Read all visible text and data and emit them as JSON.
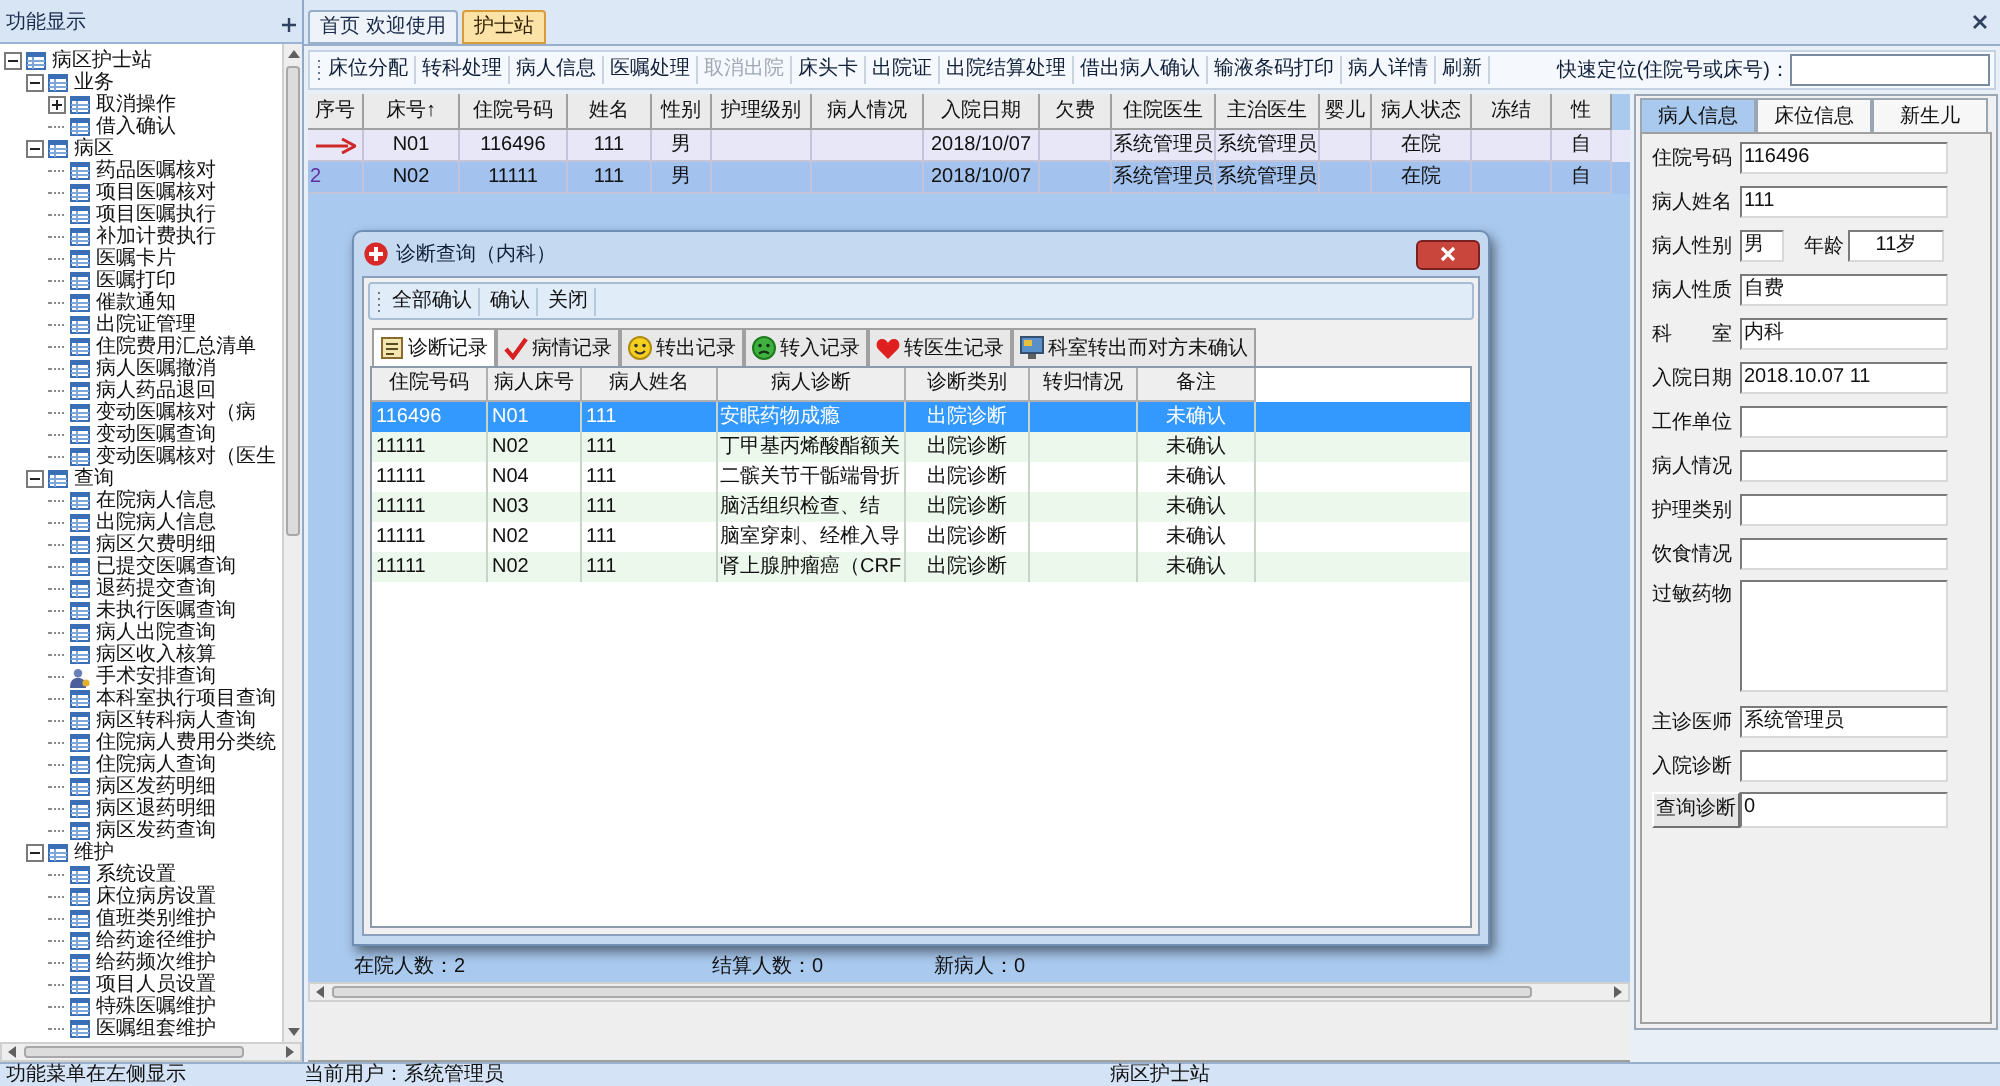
{
  "sidebar": {
    "title": "功能显示",
    "tree": [
      {
        "label": "病区护士站",
        "expanded": true,
        "children": [
          {
            "label": "业务",
            "expanded": true,
            "children": [
              {
                "label": "取消操作",
                "expanded": false
              },
              {
                "label": "借入确认"
              }
            ]
          },
          {
            "label": "病区",
            "expanded": true,
            "children": [
              {
                "label": "药品医嘱核对"
              },
              {
                "label": "项目医嘱核对"
              },
              {
                "label": "项目医嘱执行"
              },
              {
                "label": "补加计费执行"
              },
              {
                "label": "医嘱卡片"
              },
              {
                "label": "医嘱打印"
              },
              {
                "label": "催款通知"
              },
              {
                "label": "出院证管理"
              },
              {
                "label": "住院费用汇总清单"
              },
              {
                "label": "病人医嘱撤消"
              },
              {
                "label": "病人药品退回"
              },
              {
                "label": "变动医嘱核对（病"
              },
              {
                "label": "变动医嘱查询"
              },
              {
                "label": "变动医嘱核对（医生"
              }
            ]
          },
          {
            "label": "查询",
            "expanded": true,
            "children": [
              {
                "label": "在院病人信息",
                "kind": "table"
              },
              {
                "label": "出院病人信息",
                "kind": "table"
              },
              {
                "label": "病区欠费明细",
                "kind": "table"
              },
              {
                "label": "已提交医嘱查询",
                "kind": "table"
              },
              {
                "label": "退药提交查询",
                "kind": "table"
              },
              {
                "label": "未执行医嘱查询",
                "kind": "table"
              },
              {
                "label": "病人出院查询",
                "kind": "table"
              },
              {
                "label": "病区收入核算",
                "kind": "table"
              },
              {
                "label": "手术安排查询",
                "kind": "user"
              },
              {
                "label": "本科室执行项目查询",
                "kind": "table"
              },
              {
                "label": "病区转科病人查询",
                "kind": "table"
              },
              {
                "label": "住院病人费用分类统",
                "kind": "table"
              },
              {
                "label": "住院病人查询",
                "kind": "table"
              },
              {
                "label": "病区发药明细",
                "kind": "table"
              },
              {
                "label": "病区退药明细",
                "kind": "table"
              },
              {
                "label": "病区发药查询",
                "kind": "table"
              }
            ]
          },
          {
            "label": "维护",
            "expanded": true,
            "children": [
              {
                "label": "系统设置"
              },
              {
                "label": "床位病房设置"
              },
              {
                "label": "值班类别维护"
              },
              {
                "label": "给药途径维护"
              },
              {
                "label": "给药频次维护"
              },
              {
                "label": "项目人员设置"
              },
              {
                "label": "特殊医嘱维护"
              },
              {
                "label": "医嘱组套维护"
              }
            ]
          }
        ]
      }
    ]
  },
  "tabs": [
    {
      "label": "首页 欢迎使用",
      "selected": false
    },
    {
      "label": "护士站",
      "selected": true
    }
  ],
  "toolbar": {
    "items": [
      {
        "label": "床位分配",
        "disabled": false
      },
      {
        "label": "转科处理",
        "disabled": false
      },
      {
        "label": "病人信息",
        "disabled": false
      },
      {
        "label": "医嘱处理",
        "disabled": false
      },
      {
        "label": "取消出院",
        "disabled": true
      },
      {
        "label": "床头卡",
        "disabled": false
      },
      {
        "label": "出院证",
        "disabled": false
      },
      {
        "label": "出院结算处理",
        "disabled": false
      },
      {
        "label": "借出病人确认",
        "disabled": false
      },
      {
        "label": "输液条码打印",
        "disabled": false
      },
      {
        "label": "病人详情",
        "disabled": false
      },
      {
        "label": "刷新",
        "disabled": false
      }
    ],
    "quick_locate": {
      "label": "快速定位(住院号或床号)："
    }
  },
  "patients": {
    "columns": [
      "序号",
      "床号↑",
      "住院号码",
      "姓名",
      "性别",
      "护理级别",
      "病人情况",
      "入院日期",
      "欠费",
      "住院医生",
      "主治医生",
      "婴儿",
      "病人状态",
      "冻结",
      "性"
    ],
    "rows": [
      {
        "current": true,
        "selected": false,
        "bed": "N01",
        "inpatient_no": "116496",
        "name": "111",
        "sex": "男",
        "admission_date": "2018/10/07",
        "resident_doctor": "系统管理员",
        "attending_doctor": "系统管理员",
        "status": "在院",
        "column_15": "自"
      },
      {
        "current": false,
        "selected": true,
        "no": "2",
        "bed": "N02",
        "inpatient_no": "11111",
        "name": "111",
        "sex": "男",
        "admission_date": "2018/10/07",
        "resident_doctor": "系统管理员",
        "attending_doctor": "系统管理员",
        "status": "在院",
        "column_15": "自"
      }
    ]
  },
  "summary": [
    "在院人数：2",
    "结算人数：0",
    "新病人：0"
  ],
  "patient_panel": {
    "tabs": [
      {
        "label": "病人信息",
        "selected": true
      },
      {
        "label": "床位信息",
        "selected": false
      },
      {
        "label": "新生儿",
        "selected": false
      }
    ],
    "fields": [
      {
        "kind": "text",
        "label": "住院号码",
        "value": "116496"
      },
      {
        "kind": "text",
        "label": "病人姓名",
        "value": "111"
      },
      {
        "kind": "pair",
        "label": "病人性别",
        "value": "男",
        "label_2": "年龄",
        "value_2": "11岁"
      },
      {
        "kind": "text",
        "label": "病人性质",
        "value": "自费"
      },
      {
        "kind": "text",
        "label": "科　　室",
        "value": "内科"
      },
      {
        "kind": "text",
        "label": "入院日期",
        "value": "2018.10.07 11"
      },
      {
        "kind": "text",
        "label": "工作单位"
      },
      {
        "kind": "text",
        "label": "病人情况"
      },
      {
        "kind": "text",
        "label": "护理类别"
      },
      {
        "kind": "text",
        "label": "饮食情况"
      },
      {
        "kind": "area",
        "label": "过敏药物"
      },
      {
        "kind": "text",
        "label": "主诊医师",
        "value": "系统管理员"
      },
      {
        "kind": "text",
        "label": "入院诊断"
      },
      {
        "kind": "button",
        "label": "查询诊断",
        "value": "0"
      }
    ]
  },
  "dialog": {
    "title": "诊断查询（内科）",
    "toolbar": [
      "全部确认",
      "确认",
      "关闭"
    ],
    "tabs": [
      {
        "label": "诊断记录",
        "selected": true
      },
      {
        "label": "病情记录",
        "selected": false
      },
      {
        "label": "转出记录",
        "selected": false
      },
      {
        "label": "转入记录",
        "selected": false
      },
      {
        "label": "转医生记录",
        "selected": false
      },
      {
        "label": "科室转出而对方未确认",
        "selected": false
      }
    ],
    "columns": [
      "住院号码",
      "病人床号",
      "病人姓名",
      "病人诊断",
      "诊断类别",
      "转归情况",
      "备注"
    ],
    "rows": [
      {
        "selected": true,
        "inpatient_no": "116496",
        "bed": "N01",
        "name": "111",
        "diagnosis": "安眠药物成瘾",
        "type": "出院诊断",
        "note": "未确认"
      },
      {
        "selected": false,
        "inpatient_no": "11111",
        "bed": "N02",
        "name": "111",
        "diagnosis": "丁甲基丙烯酸酯额关",
        "type": "出院诊断",
        "note": "未确认"
      },
      {
        "selected": false,
        "inpatient_no": "11111",
        "bed": "N04",
        "name": "111",
        "diagnosis": "二髌关节干骺端骨折",
        "type": "出院诊断",
        "note": "未确认"
      },
      {
        "selected": false,
        "inpatient_no": "11111",
        "bed": "N03",
        "name": "111",
        "diagnosis": "脑活组织检查、结",
        "type": "出院诊断",
        "note": "未确认"
      },
      {
        "selected": false,
        "inpatient_no": "11111",
        "bed": "N02",
        "name": "111",
        "diagnosis": "脑室穿刺、经椎入导",
        "type": "出院诊断",
        "note": "未确认"
      },
      {
        "selected": false,
        "inpatient_no": "11111",
        "bed": "N02",
        "name": "111",
        "diagnosis": "肾上腺肿瘤癌（CRF",
        "type": "出院诊断",
        "note": "未确认"
      }
    ]
  },
  "status_bar": [
    "功能菜单在左侧显示",
    "当前用户：系统管理员",
    "病区护士站"
  ]
}
